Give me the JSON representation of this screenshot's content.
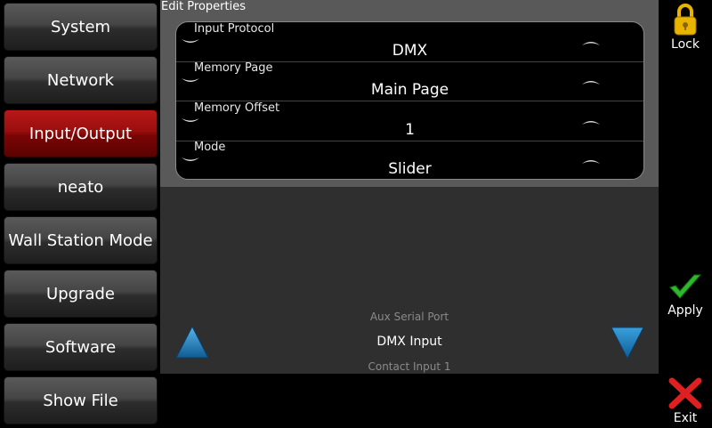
{
  "sidebar": {
    "items": [
      {
        "label": "System",
        "active": false
      },
      {
        "label": "Network",
        "active": false
      },
      {
        "label": "Input/Output",
        "active": true
      },
      {
        "label": "neato",
        "active": false
      },
      {
        "label": "Wall Station Mode",
        "active": false
      },
      {
        "label": "Upgrade",
        "active": false
      },
      {
        "label": "Software",
        "active": false
      },
      {
        "label": "Show File",
        "active": false
      }
    ]
  },
  "panel": {
    "title": "Edit Properties",
    "properties": [
      {
        "label": "Input Protocol",
        "value": "DMX"
      },
      {
        "label": "Memory Page",
        "value": "Main Page"
      },
      {
        "label": "Memory Offset",
        "value": "1"
      },
      {
        "label": "Mode",
        "value": "Slider"
      }
    ]
  },
  "selector": {
    "previous": "Aux Serial Port",
    "current": "DMX Input",
    "next": "Contact Input 1"
  },
  "actions": {
    "lock_label": "Lock",
    "apply_label": "Apply",
    "exit_label": "Exit"
  },
  "colors": {
    "active_nav": "#9a0e0e",
    "lock": "#e8b400",
    "apply": "#2db82d",
    "exit": "#e02020",
    "arrow": "#2a8fd0"
  }
}
